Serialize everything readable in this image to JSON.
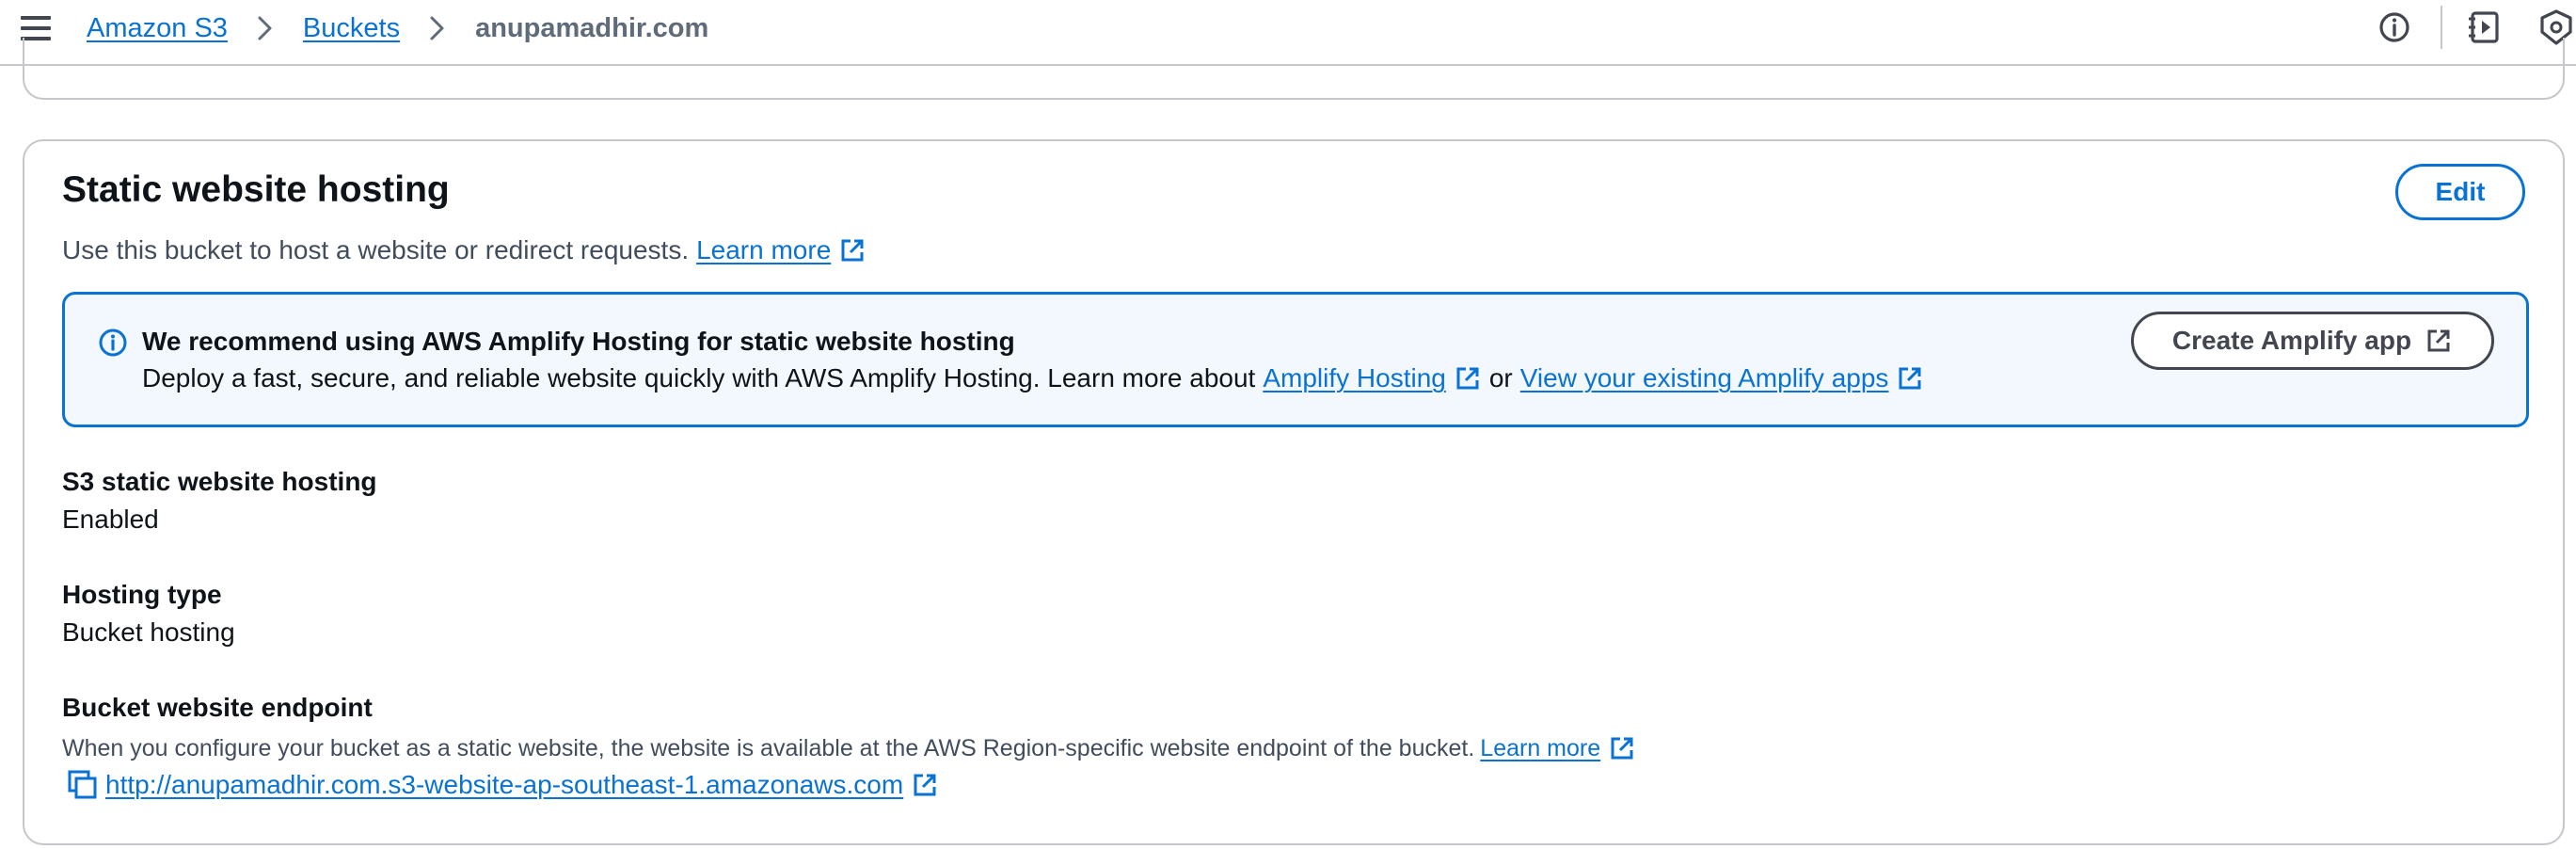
{
  "topbar": {
    "menu_icon": "hamburger-menu-icon",
    "breadcrumbs": [
      {
        "label": "Amazon S3"
      },
      {
        "label": "Buckets"
      },
      {
        "label": "anupamadhir.com"
      }
    ],
    "right_icons": [
      "info-circle-icon",
      "notes-panel-icon",
      "shield-settings-icon"
    ]
  },
  "panel": {
    "title": "Static website hosting",
    "edit_label": "Edit",
    "description": "Use this bucket to host a website or redirect requests.",
    "learn_more": "Learn more"
  },
  "alert": {
    "icon": "info-icon",
    "title": "We recommend using AWS Amplify Hosting for static website hosting",
    "body_prefix": "Deploy a fast, secure, and reliable website quickly with AWS Amplify Hosting. Learn more about",
    "link_1": "Amplify Hosting",
    "or_word": "or",
    "link_2": "View your existing Amplify apps",
    "button_label": "Create Amplify app"
  },
  "properties": {
    "hosting_label": "S3 static website hosting",
    "hosting_value": "Enabled",
    "type_label": "Hosting type",
    "type_value": "Bucket hosting",
    "endpoint_label": "Bucket website endpoint",
    "endpoint_desc": "When you configure your bucket as a static website, the website is available at the AWS Region-specific website endpoint of the bucket.",
    "endpoint_learn_more": "Learn more",
    "endpoint_url": "http://anupamadhir.com.s3-website-ap-southeast-1.amazonaws.com"
  },
  "colors": {
    "link": "#0972d3",
    "info_bg": "#f2f8fd",
    "border": "#c6c6cd",
    "text": "#0f141a"
  }
}
